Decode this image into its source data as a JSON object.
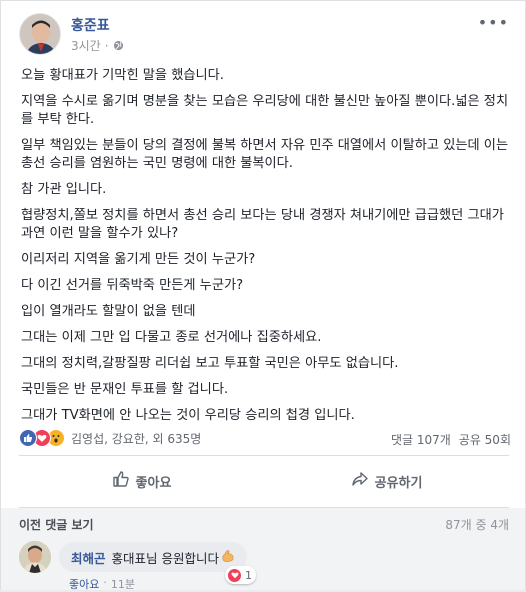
{
  "post": {
    "author": "홍준표",
    "time": "3시간",
    "more_label": "•••",
    "body": [
      "오늘 황대표가 기막힌 말을 했습니다.",
      "지역을 수시로 옮기며 명분을 찾는 모습은 우리당에 대한 불신만 높아질 뿐이다.넓은 정치를 부탁 한다.",
      "일부 책임있는 분들이 당의 결정에 불복 하면서 자유 민주 대열에서 이탈하고 있는데 이는 총선 승리를 염원하는 국민 명령에 대한 불복이다.",
      "참 가관 입니다.",
      "협량정치,쫄보 정치를 하면서 총선 승리 보다는 당내 경쟁자 쳐내기에만 급급했던 그대가 과연 이런 말을 할수가 있나?",
      "이리저리 지역을 옮기게 만든 것이 누군가?",
      "다 이긴 선거를 뒤죽박죽 만든게 누군가?",
      "입이 열개라도 할말이 없을 텐데",
      "그대는 이제 그만 입 다물고 종로 선거에나 집중하세요.",
      "그대의 정치력,갈팡질팡 리더쉽 보고 투표할 국민은 아무도 없습니다.",
      "국민들은 반 문재인 투표를 할 겁니다.",
      "그대가 TV화면에 안 나오는 것이 우리당 승리의 첩경 입니다."
    ]
  },
  "stats": {
    "reaction_names": "김영섭, 강요한, 외 635명",
    "comments": "댓글 107개",
    "shares": "공유 50회"
  },
  "actions": {
    "like": "좋아요",
    "share": "공유하기"
  },
  "comments": {
    "prev_label": "이전 댓글 보기",
    "count_label": "87개 중 4개",
    "items": [
      {
        "author": "최해곤",
        "text": "홍대표님 응원합니다",
        "reaction_count": "1",
        "like_label": "좋아요",
        "time": "11분"
      }
    ]
  },
  "colors": {
    "link_blue": "#365899",
    "like_blue": "#4267b2",
    "love_red": "#f33e58",
    "wow_yellow": "#f7b125"
  },
  "icons": {
    "reactions": [
      "like-icon",
      "love-icon",
      "wow-icon"
    ],
    "action_like": "thumbs-up-icon",
    "action_share": "share-arrow-icon",
    "privacy": "globe-icon"
  }
}
